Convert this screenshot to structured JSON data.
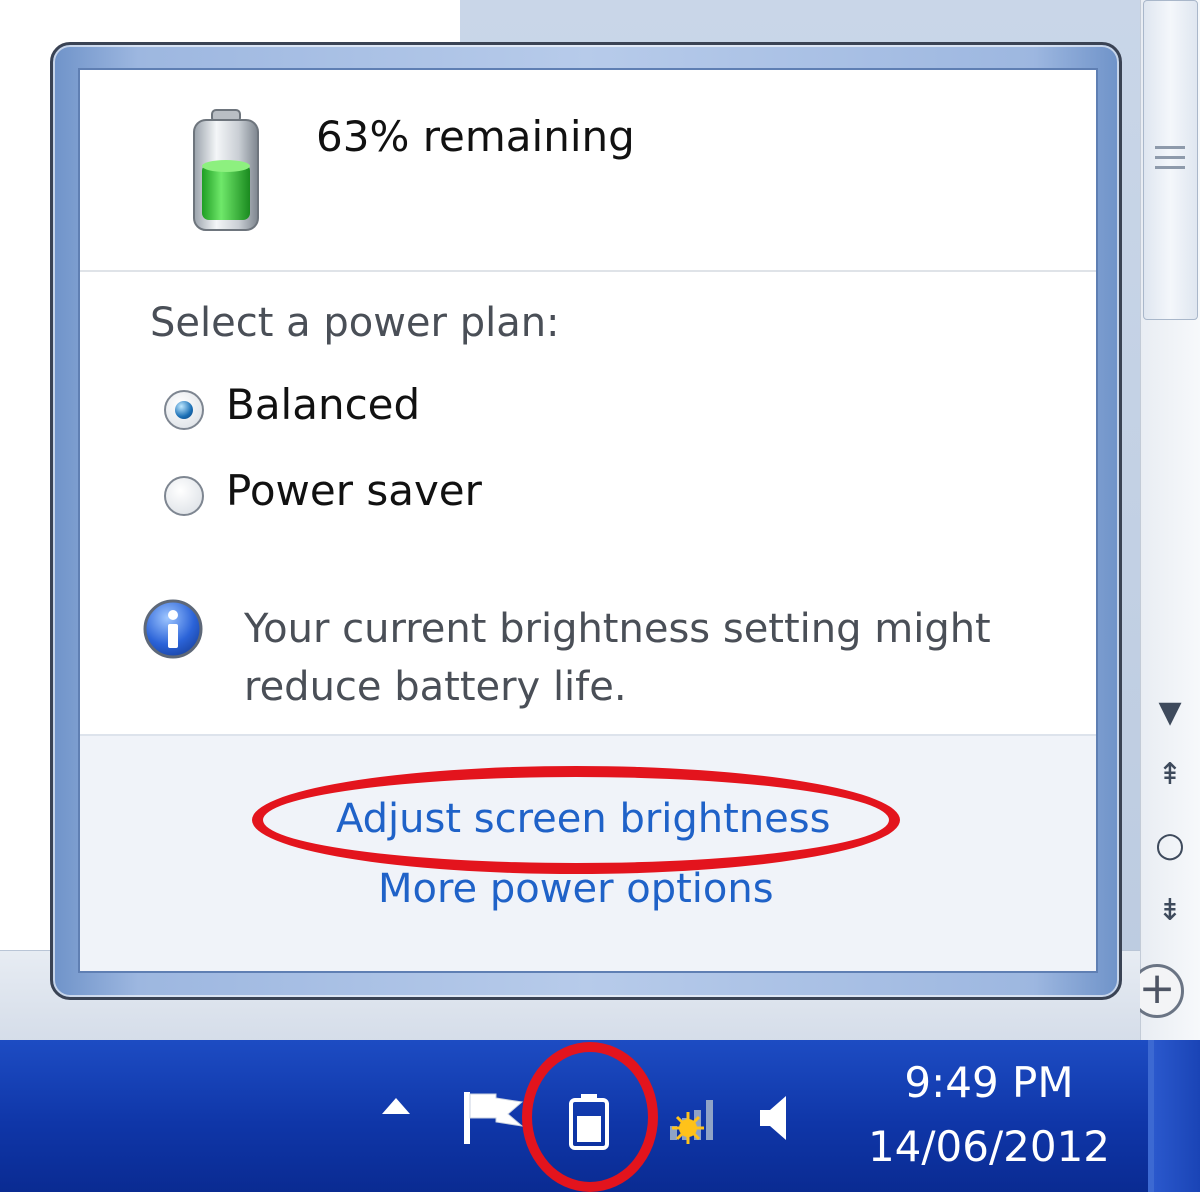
{
  "battery": {
    "status_text": "63% remaining",
    "percent": 63
  },
  "power_plan": {
    "label": "Select a power plan:",
    "options": [
      {
        "label": "Balanced",
        "selected": true
      },
      {
        "label": "Power saver",
        "selected": false
      }
    ]
  },
  "info": {
    "message": "Your current brightness setting might reduce battery life."
  },
  "links": {
    "adjust_brightness": "Adjust screen brightness",
    "more_options": "More power options"
  },
  "taskbar": {
    "time": "9:49 PM",
    "date": "14/06/2012"
  },
  "colors": {
    "link": "#1f62c8",
    "highlight": "#e3141d",
    "taskbar": "#0f36a8",
    "battery_fill": "#39c93a"
  },
  "icons": [
    "battery-icon",
    "radio-button",
    "info-icon",
    "show-hidden-icons-arrow",
    "action-center-flag-icon",
    "battery-tray-icon",
    "network-icon",
    "volume-icon"
  ]
}
